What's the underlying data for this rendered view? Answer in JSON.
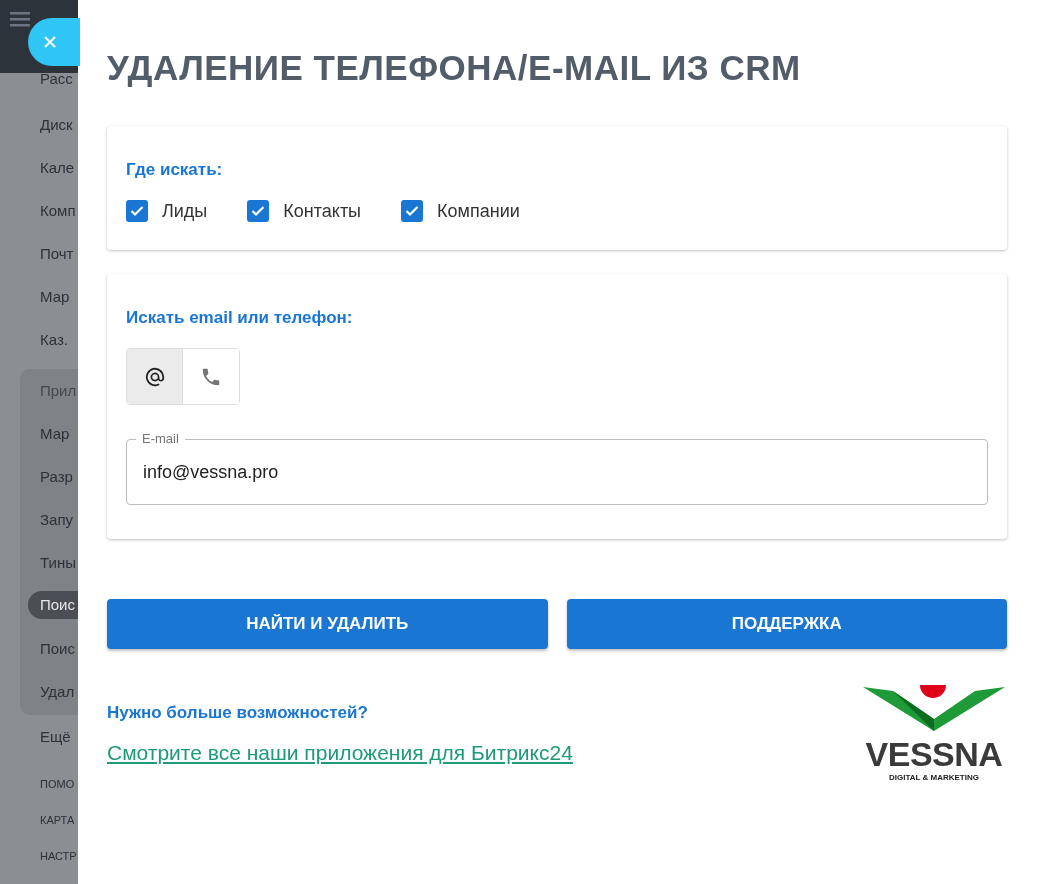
{
  "sidebar": {
    "top_item": "Расс",
    "items": [
      {
        "label": "Диск",
        "selected": false
      },
      {
        "label": "Кале",
        "selected": false
      },
      {
        "label": "Комп",
        "selected": false
      },
      {
        "label": "Почт",
        "selected": false
      },
      {
        "label": "Мар",
        "selected": false
      },
      {
        "label": "Каз.",
        "selected": false
      }
    ],
    "group": {
      "title": "Прил",
      "items": [
        {
          "label": "Мар",
          "selected": false
        },
        {
          "label": "Разр",
          "selected": false
        },
        {
          "label": "Запу",
          "selected": false
        },
        {
          "label": "Тины",
          "selected": false
        },
        {
          "label": "Поис",
          "selected": true
        },
        {
          "label": "Поис",
          "selected": false
        },
        {
          "label": "Удал",
          "selected": false
        }
      ]
    },
    "more": "Ещё",
    "footer_links": [
      "ПОМО",
      "КАРТА",
      "НАСТР"
    ]
  },
  "title": "УДАЛЕНИЕ ТЕЛЕФОНА/E-MAIL ИЗ CRM",
  "where": {
    "label": "Где искать:",
    "options": [
      {
        "label": "Лиды",
        "checked": true
      },
      {
        "label": "Контакты",
        "checked": true
      },
      {
        "label": "Компании",
        "checked": true
      }
    ]
  },
  "search": {
    "label": "Искать email или телефон:",
    "modes": [
      {
        "kind": "email",
        "selected": true
      },
      {
        "kind": "phone",
        "selected": false
      }
    ],
    "field_label": "E-mail",
    "value": "info@vessna.pro"
  },
  "buttons": [
    "НАЙТИ И УДАЛИТЬ",
    "ПОДДЕРЖКА"
  ],
  "promo": {
    "question": "Нужно больше возможностей?",
    "link": "Смотрите все наши приложения для Битрикс24"
  },
  "logo": {
    "name": "VESSNA",
    "tagline": "DIGITAL & MARKETING"
  }
}
